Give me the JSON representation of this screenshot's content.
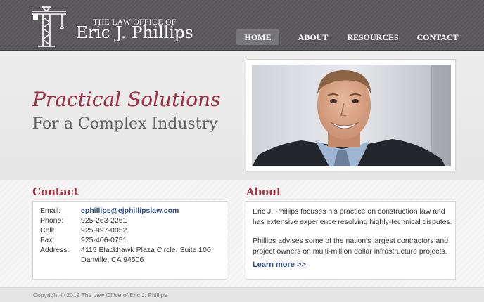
{
  "logo": {
    "line1": "THE LAW OFFICE OF",
    "line2": "Eric J. Phillips"
  },
  "nav": [
    {
      "label": "HOME",
      "active": true
    },
    {
      "label": "ABOUT",
      "active": false
    },
    {
      "label": "RESOURCES",
      "active": false
    },
    {
      "label": "CONTACT",
      "active": false
    }
  ],
  "hero": {
    "tagline_line1": "Practical Solutions",
    "tagline_line2": "For a Complex Industry"
  },
  "contact": {
    "title": "Contact",
    "rows": [
      {
        "label": "Email:",
        "value": "ephillips@ejphillipslaw.com"
      },
      {
        "label": "Phone:",
        "value": "925-263-2261"
      },
      {
        "label": "Cell:",
        "value": "925-997-0052"
      },
      {
        "label": "Fax:",
        "value": "925-406-0751"
      },
      {
        "label": "Address:",
        "value": "4115 Blackhawk Plaza Circle, Suite 100"
      },
      {
        "label": "",
        "value": "Danville, CA 94506"
      }
    ]
  },
  "about": {
    "title": "About",
    "para1": "Eric J. Phillips focuses his practice on construction law and has extensive experience resolving highly-technical disputes.",
    "para2": "Phillips advises some of the nation's largest contractors and project owners on multi-million dollar infrastructure projects.",
    "learn_more": "Learn more >>"
  },
  "footer": {
    "copyright": "Copyright © 2012 The Law Office of Eric J. Phillips"
  },
  "colors": {
    "header_bg": "#5a585d",
    "accent_red": "#a03044",
    "link_blue": "#2b4c8f"
  }
}
